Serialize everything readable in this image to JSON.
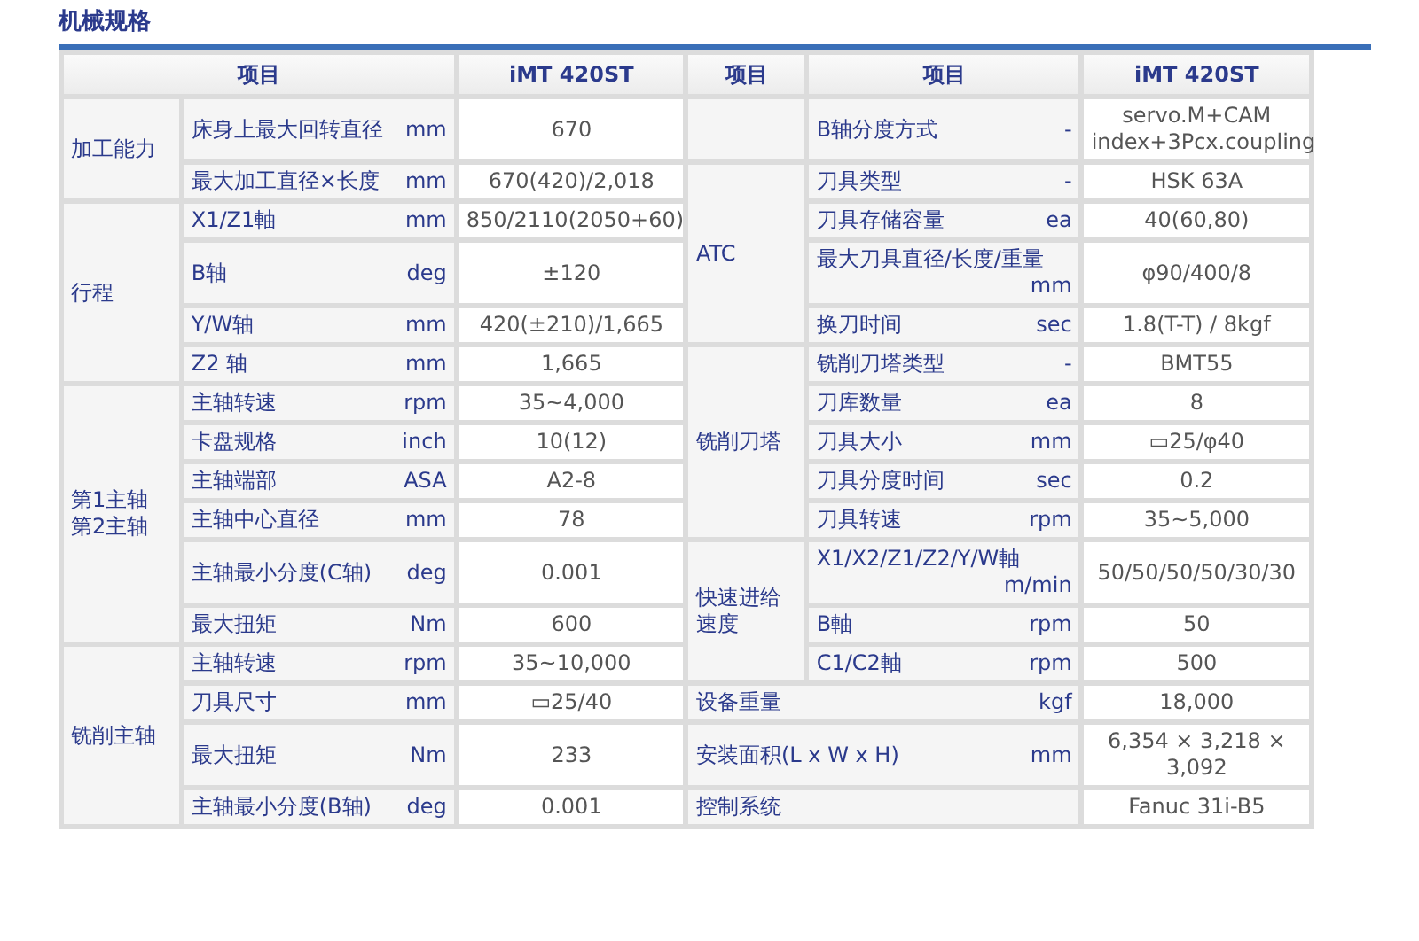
{
  "title": "机械规格",
  "header": {
    "left": {
      "item": "项目",
      "value": "iMT 420ST"
    },
    "right": {
      "group": "项目",
      "item": "项目",
      "value": "iMT 420ST"
    }
  },
  "left_sections": [
    {
      "group": [
        "加工能力"
      ],
      "items": [
        {
          "label": "床身上最大回转直径",
          "unit": "mm",
          "value": "670"
        },
        {
          "label": "最大加工直径×长度",
          "unit": "mm",
          "value": "670(420)/2,018"
        }
      ]
    },
    {
      "group": [
        "行程"
      ],
      "items": [
        {
          "label": "X1/Z1軸",
          "unit": "mm",
          "value": "850/2110(2050+60)"
        },
        {
          "label": "B轴",
          "unit": "deg",
          "value": "±120"
        },
        {
          "label": "Y/W轴",
          "unit": "mm",
          "value": "420(±210)/1,665"
        },
        {
          "label": "Z2 轴",
          "unit": "mm",
          "value": "1,665"
        }
      ]
    },
    {
      "group": [
        "第1主轴",
        "第2主轴"
      ],
      "items": [
        {
          "label": "主轴转速",
          "unit": "rpm",
          "value": "35~4,000"
        },
        {
          "label": "卡盘规格",
          "unit": "inch",
          "value": "10(12)"
        },
        {
          "label": "主轴端部",
          "unit": "ASA",
          "value": "A2-8"
        },
        {
          "label": "主轴中心直径",
          "unit": "mm",
          "value": "78"
        },
        {
          "label": "主轴最小分度(C轴)",
          "unit": "deg",
          "value": "0.001"
        },
        {
          "label": "最大扭矩",
          "unit": "Nm",
          "value": "600"
        }
      ]
    },
    {
      "group": [
        "铣削主轴"
      ],
      "items": [
        {
          "label": "主轴转速",
          "unit": "rpm",
          "value": "35~10,000"
        },
        {
          "label": "刀具尺寸",
          "unit": "mm",
          "value": "▭25/40"
        },
        {
          "label": "最大扭矩",
          "unit": "Nm",
          "value": "233"
        },
        {
          "label": "主轴最小分度(B轴)",
          "unit": "deg",
          "value": "0.001"
        }
      ]
    }
  ],
  "right_sections": [
    {
      "kind": "group",
      "items": [
        {
          "label": "B轴分度方式",
          "unit": "-",
          "value": "servo.M+CAM index+3Pcx.coupling"
        }
      ]
    },
    {
      "kind": "group",
      "group": [
        "ATC"
      ],
      "items": [
        {
          "label": "刀具类型",
          "unit": "-",
          "value": "HSK 63A"
        },
        {
          "label": "刀具存储容量",
          "unit": "ea",
          "value": "40(60,80)"
        },
        {
          "label": "最大刀具直径/长度/重量",
          "unit": "mm",
          "value": "φ90/400/8"
        },
        {
          "label": "换刀时间",
          "unit": "sec",
          "value": "1.8(T-T) / 8kgf"
        }
      ]
    },
    {
      "kind": "group",
      "group": [
        "铣削刀塔"
      ],
      "items": [
        {
          "label": "铣削刀塔类型",
          "unit": "-",
          "value": "BMT55"
        },
        {
          "label": "刀库数量",
          "unit": "ea",
          "value": "8"
        },
        {
          "label": "刀具大小",
          "unit": "mm",
          "value": "▭25/φ40"
        },
        {
          "label": "刀具分度时间",
          "unit": "sec",
          "value": "0.2"
        },
        {
          "label": "刀具转速",
          "unit": "rpm",
          "value": "35~5,000"
        }
      ]
    },
    {
      "kind": "group",
      "group": [
        "快速进给",
        "速度"
      ],
      "items": [
        {
          "label": "X1/X2/Z1/Z2/Y/W軸",
          "unit": "m/min",
          "value": "50/50/50/50/30/30"
        },
        {
          "label": "B軸",
          "unit": "rpm",
          "value": "50"
        },
        {
          "label": "C1/C2軸",
          "unit": "rpm",
          "value": "500"
        }
      ]
    },
    {
      "kind": "wide",
      "items": [
        {
          "label": "设备重量",
          "unit": "kgf",
          "value": "18,000"
        }
      ]
    },
    {
      "kind": "wide",
      "items": [
        {
          "label": "安装面积(L x W x H)",
          "unit": "mm",
          "value": "6,354 × 3,218 × 3,092"
        }
      ]
    },
    {
      "kind": "wide",
      "items": [
        {
          "label": "控制系统",
          "value": "Fanuc 31i-B5"
        }
      ]
    }
  ]
}
